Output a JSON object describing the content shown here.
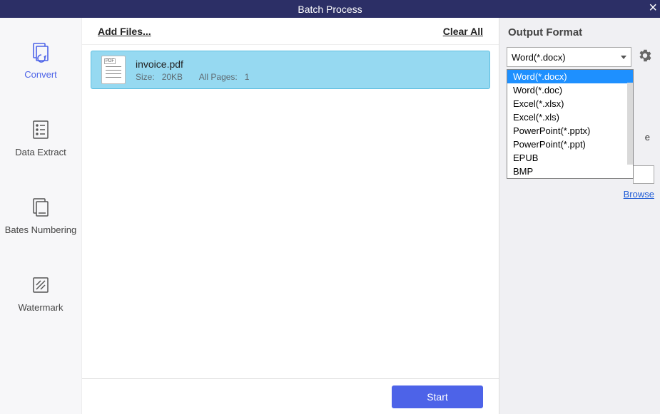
{
  "titlebar": {
    "title": "Batch Process"
  },
  "sidebar": {
    "items": [
      {
        "label": "Convert"
      },
      {
        "label": "Data Extract"
      },
      {
        "label": "Bates Numbering"
      },
      {
        "label": "Watermark"
      }
    ]
  },
  "toolbar": {
    "add_files": "Add Files...",
    "clear_all": "Clear All"
  },
  "files": [
    {
      "name": "invoice.pdf",
      "size_label": "Size:",
      "size_value": "20KB",
      "pages_label": "All Pages:",
      "pages_value": "1"
    }
  ],
  "bottom": {
    "start": "Start"
  },
  "right": {
    "title": "Output Format",
    "selected": "Word(*.docx)",
    "options": [
      "Word(*.docx)",
      "Word(*.doc)",
      "Excel(*.xlsx)",
      "Excel(*.xls)",
      "PowerPoint(*.pptx)",
      "PowerPoint(*.ppt)",
      "EPUB",
      "BMP"
    ],
    "truncated_char": "e",
    "browse": "Browse"
  }
}
